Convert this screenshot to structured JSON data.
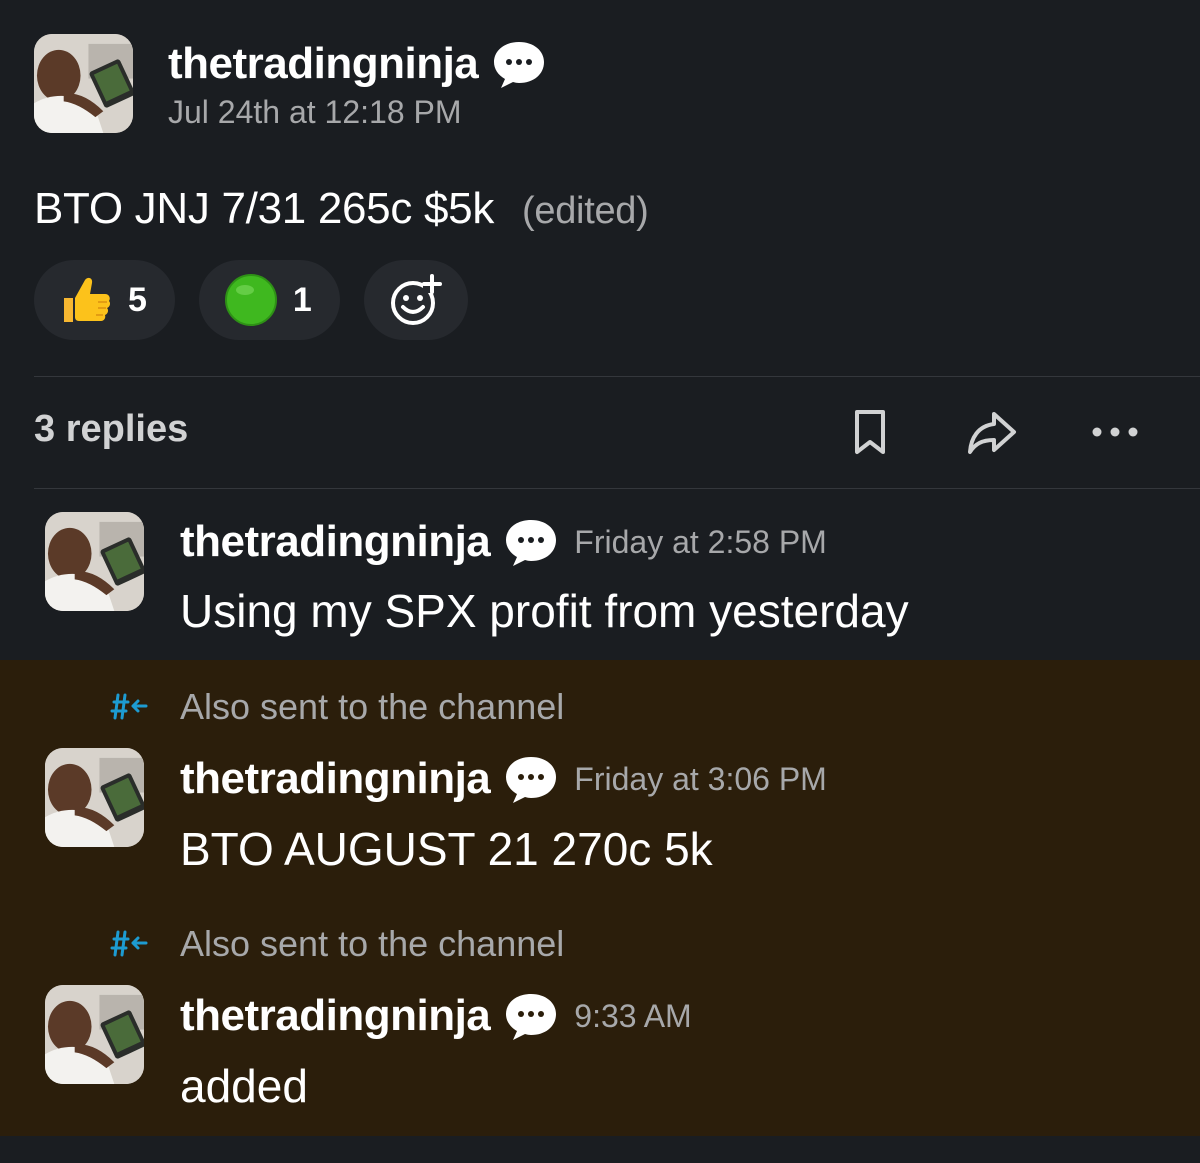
{
  "parent_message": {
    "author": "thetradingninja",
    "timestamp": "Jul 24th at 12:18 PM",
    "text": "BTO JNJ 7/31 265c $5k",
    "edited_label": "(edited)",
    "status_icon": "speech-bubble-icon",
    "reactions": [
      {
        "emoji": "thumbs-up-icon",
        "count": "5"
      },
      {
        "emoji": "green-circle-icon",
        "count": "1"
      }
    ],
    "add_reaction_icon": "add-reaction-icon"
  },
  "thread": {
    "replies_label": "3 replies",
    "actions": [
      "bookmark-icon",
      "share-icon",
      "more-icon"
    ]
  },
  "replies": [
    {
      "author": "thetradingninja",
      "timestamp": "Friday at 2:58 PM",
      "text": "Using my SPX profit from yesterday",
      "also_sent": ""
    },
    {
      "author": "thetradingninja",
      "timestamp": "Friday at 3:06 PM",
      "text": "BTO AUGUST 21 270c 5k",
      "also_sent": "Also sent to the channel"
    },
    {
      "author": "thetradingninja",
      "timestamp": "9:33 AM",
      "text": "added",
      "also_sent": "Also sent to the channel"
    }
  ],
  "colors": {
    "background": "#1a1d21",
    "highlight": "#2b1e0b",
    "author": "#ffffff",
    "muted": "#a7a8aa",
    "reaction_pill": "#26292e",
    "channel_icon": "#1d9bd1"
  }
}
